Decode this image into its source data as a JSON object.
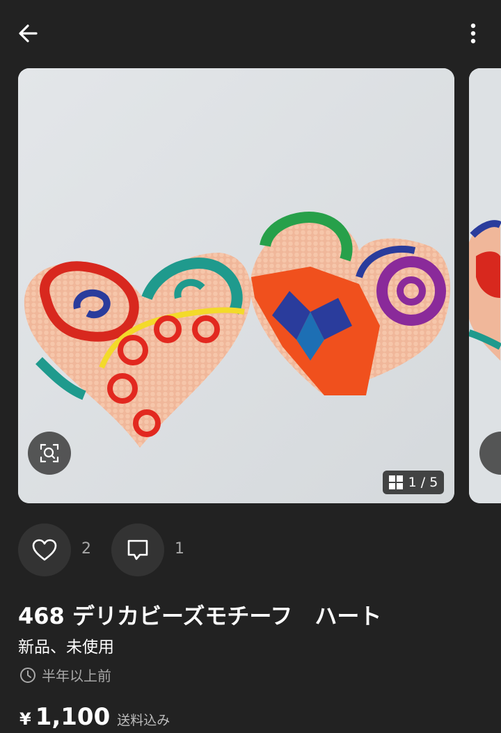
{
  "header": {
    "back_icon": "arrow-left-icon",
    "more_icon": "more-vertical-icon"
  },
  "gallery": {
    "current_page": 1,
    "total_pages": 5,
    "page_indicator": "1 / 5",
    "zoom_icon": "zoom-search-icon",
    "grid_icon": "grid-icon"
  },
  "actions": {
    "like_count": "2",
    "comment_count": "1"
  },
  "item": {
    "title": "468 デリカビーズモチーフ　ハート",
    "condition": "新品、未使用",
    "posted": "半年以上前",
    "currency": "¥",
    "price": "1,100",
    "shipping": "送料込み"
  },
  "colors": {
    "background": "#222222",
    "text_secondary": "#a8a8a8",
    "button_bg": "#333333"
  }
}
